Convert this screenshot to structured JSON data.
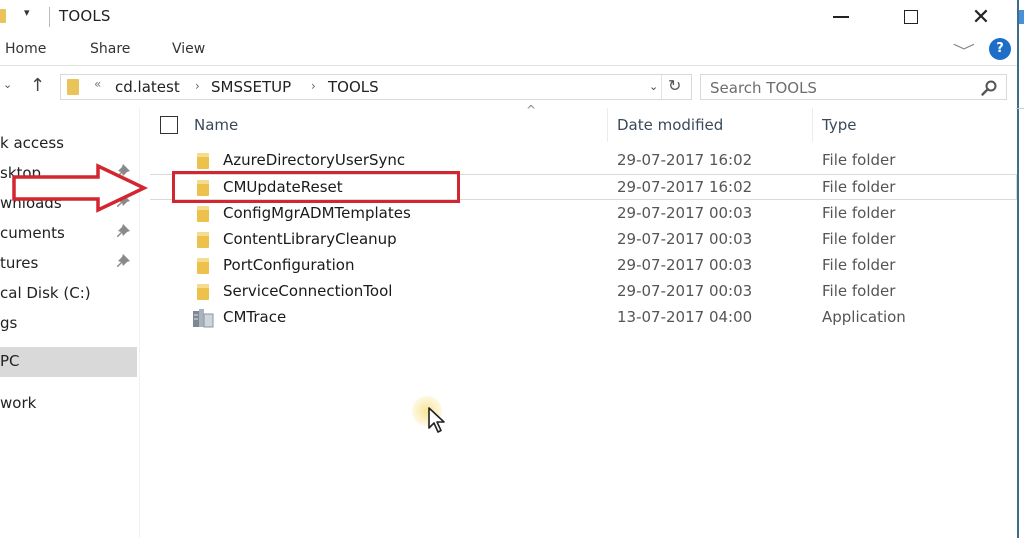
{
  "window": {
    "title": "TOOLS",
    "quick_access_dropdown": "▾",
    "controls": {
      "minimize": "minimize",
      "maximize": "maximize",
      "close": "✕"
    }
  },
  "ribbon": {
    "tabs": [
      "Home",
      "Share",
      "View"
    ],
    "expand_icon": "﹀",
    "help_icon": "?"
  },
  "nav": {
    "recent_icon": "⌄",
    "up_icon": "↑",
    "overflow": "«",
    "breadcrumb": [
      "cd.latest",
      "SMSSETUP",
      "TOOLS"
    ],
    "separator": "›",
    "dropdown_icon": "⌄",
    "refresh_icon": "↻",
    "search_placeholder": "Search TOOLS"
  },
  "sidebar": {
    "items": [
      {
        "label": "k access",
        "pinned": false,
        "selected": false
      },
      {
        "label": "sktop",
        "pinned": true,
        "selected": false
      },
      {
        "label": "wnloads",
        "pinned": true,
        "selected": false
      },
      {
        "label": "cuments",
        "pinned": true,
        "selected": false
      },
      {
        "label": "tures",
        "pinned": true,
        "selected": false
      },
      {
        "label": "cal Disk (C:)",
        "pinned": false,
        "selected": false
      },
      {
        "label": "gs",
        "pinned": false,
        "selected": false
      },
      {
        "label": " PC",
        "pinned": false,
        "selected": true
      },
      {
        "label": "work",
        "pinned": false,
        "selected": false
      }
    ]
  },
  "columns": {
    "sort_indicator": "^",
    "headers": [
      "Name",
      "Date modified",
      "Type"
    ]
  },
  "files": [
    {
      "name": "AzureDirectoryUserSync",
      "date": "29-07-2017 16:02",
      "type": "File folder",
      "icon": "folder-icon",
      "highlighted": false
    },
    {
      "name": "CMUpdateReset",
      "date": "29-07-2017 16:02",
      "type": "File folder",
      "icon": "folder-icon",
      "highlighted": true
    },
    {
      "name": "ConfigMgrADMTemplates",
      "date": "29-07-2017 00:03",
      "type": "File folder",
      "icon": "folder-icon",
      "highlighted": false
    },
    {
      "name": "ContentLibraryCleanup",
      "date": "29-07-2017 00:03",
      "type": "File folder",
      "icon": "folder-icon",
      "highlighted": false
    },
    {
      "name": "PortConfiguration",
      "date": "29-07-2017 00:03",
      "type": "File folder",
      "icon": "folder-icon",
      "highlighted": false
    },
    {
      "name": "ServiceConnectionTool",
      "date": "29-07-2017 00:03",
      "type": "File folder",
      "icon": "folder-icon",
      "highlighted": false
    },
    {
      "name": "CMTrace",
      "date": "13-07-2017 04:00",
      "type": "Application",
      "icon": "application-icon",
      "highlighted": false
    }
  ],
  "annotation": {
    "color": "#d32630",
    "target": "CMUpdateReset"
  }
}
